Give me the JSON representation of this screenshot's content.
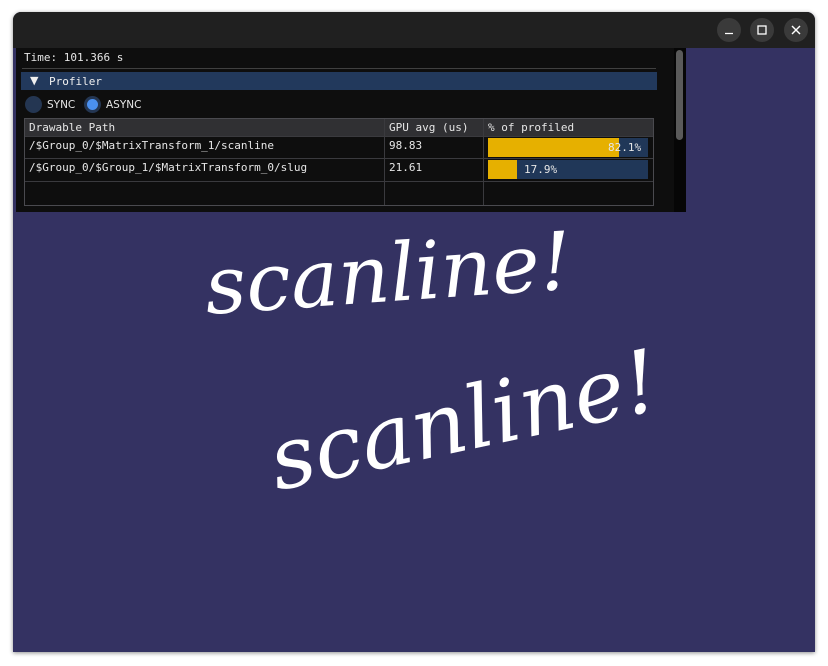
{
  "status": {
    "time_text": "Time: 101.366 s"
  },
  "profiler": {
    "header_arrow": "▼",
    "header_label": "Profiler",
    "modes": {
      "sync_label": "SYNC",
      "async_label": "ASYNC",
      "selected": "ASYNC"
    },
    "table": {
      "columns": [
        "Drawable Path",
        "GPU avg (us)",
        "% of profiled"
      ],
      "rows": [
        {
          "path": "/$Group_0/$MatrixTransform_1/scanline",
          "gpu_avg": "98.83",
          "percent_label": "82.1%",
          "percent": 82.1
        },
        {
          "path": "/$Group_0/$Group_1/$MatrixTransform_0/slug",
          "gpu_avg": "21.61",
          "percent_label": "17.9%",
          "percent": 17.9
        }
      ]
    }
  },
  "canvas": {
    "text_1": "scanline!",
    "text_2": "scanline!"
  },
  "colors": {
    "canvas_bg": "#343262",
    "bar_fill": "#e6b000",
    "bar_bg": "#203758",
    "header_bg": "#22395c",
    "radio_selected": "#4a90f0"
  },
  "icons": [
    "minimize-icon",
    "maximize-icon",
    "close-icon",
    "collapse-arrow-icon"
  ]
}
